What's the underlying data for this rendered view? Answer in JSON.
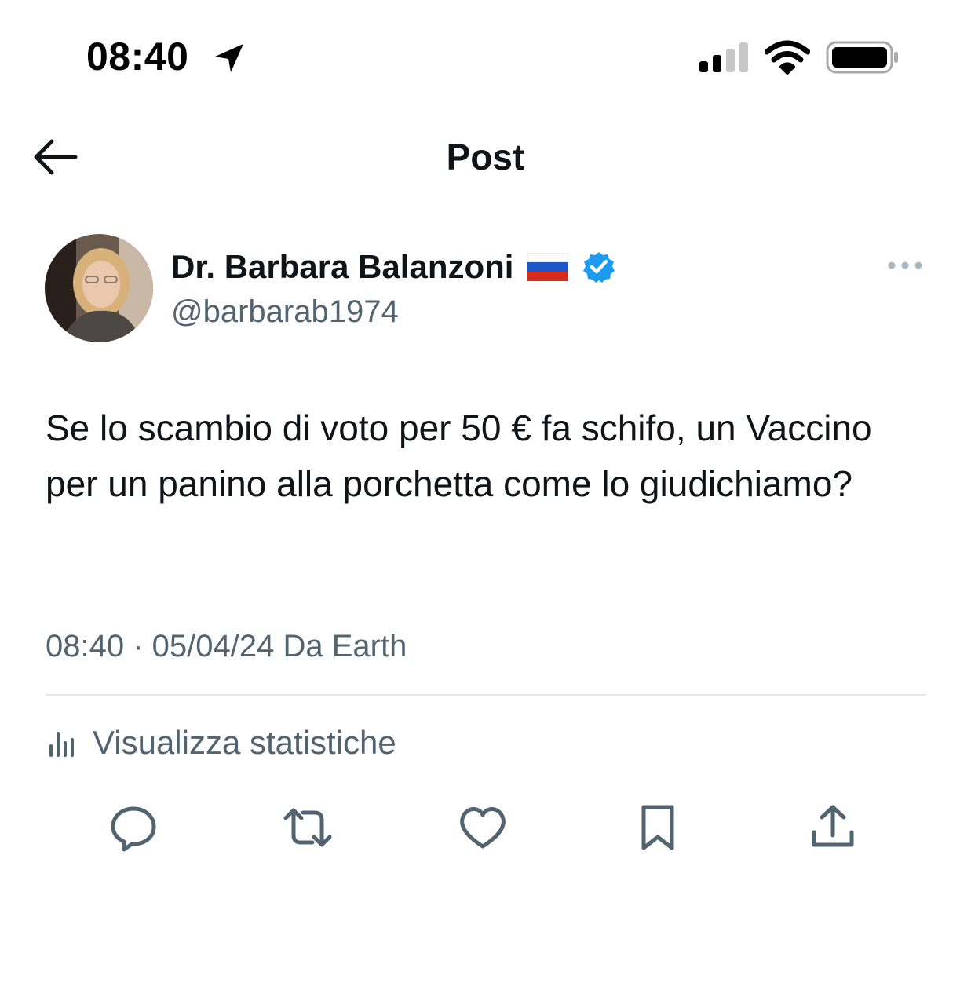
{
  "status_bar": {
    "time": "08:40",
    "icons": [
      "location-arrow-icon",
      "cellular-signal-icon",
      "wifi-icon",
      "battery-icon"
    ]
  },
  "header": {
    "title": "Post",
    "back_icon": "arrow-left-icon"
  },
  "post": {
    "author": {
      "display_name": "Dr. Barbara Balanzoni",
      "flag": "🇷🇺",
      "verified": true,
      "handle": "@barbarab1974"
    },
    "text": "Se lo scambio di voto per 50 € fa schifo, un Vaccino per un panino alla porchetta come lo giudichiamo?",
    "meta": "08:40 · 05/04/24 Da Earth",
    "stats_label": "Visualizza statistiche",
    "actions": [
      "reply-icon",
      "repost-icon",
      "like-icon",
      "bookmark-icon",
      "share-icon"
    ]
  },
  "colors": {
    "text_primary": "#0f1419",
    "text_secondary": "#536471",
    "verified_blue": "#1d9bf0",
    "divider": "#e6e9eb"
  }
}
